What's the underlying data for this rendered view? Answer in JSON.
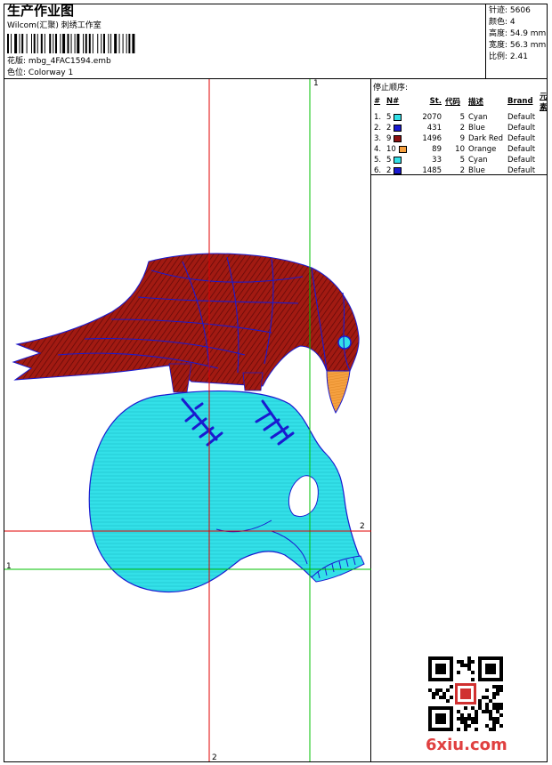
{
  "header": {
    "title": "生产作业图",
    "company": "Wilcom(汇聚) 刺绣工作室",
    "design_label": "花版:",
    "design_value": "mbg_4FAC1594.emb",
    "colorway_label": "色位:",
    "colorway_value": "Colorway 1"
  },
  "stats": {
    "stitches": "针迹: 5606",
    "colors": "颜色: 4",
    "height": "高度: 54.9 mm",
    "width": "宽度: 56.3 mm",
    "ratio": "比例: 2.41"
  },
  "sequence": {
    "title": "停止顺序:",
    "headers": [
      "#",
      "N#",
      "St.",
      "代码",
      "描述",
      "Brand",
      "元素"
    ],
    "rows": [
      {
        "idx": "1.",
        "n": "5",
        "color": "#33e0e8",
        "st": "2070",
        "code": "5",
        "desc": "Cyan",
        "brand": "Default"
      },
      {
        "idx": "2.",
        "n": "2",
        "color": "#1a1ad0",
        "st": "431",
        "code": "2",
        "desc": "Blue",
        "brand": "Default"
      },
      {
        "idx": "3.",
        "n": "9",
        "color": "#8b1010",
        "st": "1496",
        "code": "9",
        "desc": "Dark Red",
        "brand": "Default"
      },
      {
        "idx": "4.",
        "n": "10",
        "color": "#f5a040",
        "st": "89",
        "code": "10",
        "desc": "Orange",
        "brand": "Default"
      },
      {
        "idx": "5.",
        "n": "5",
        "color": "#33e0e8",
        "st": "33",
        "code": "5",
        "desc": "Cyan",
        "brand": "Default"
      },
      {
        "idx": "6.",
        "n": "2",
        "color": "#1a1ad0",
        "st": "1485",
        "code": "2",
        "desc": "Blue",
        "brand": "Default"
      }
    ]
  },
  "axes": {
    "green_v_label": "1",
    "green_h_label": "1",
    "red_h_label": "2",
    "red_v_label": "2"
  },
  "colors": {
    "cyan": "#33e0e8",
    "blue": "#1a1ad0",
    "dark_red": "#8b1010",
    "orange": "#f5a040",
    "red_axis": "#e00000",
    "green_axis": "#00c000"
  },
  "watermark": "6xiu.com"
}
